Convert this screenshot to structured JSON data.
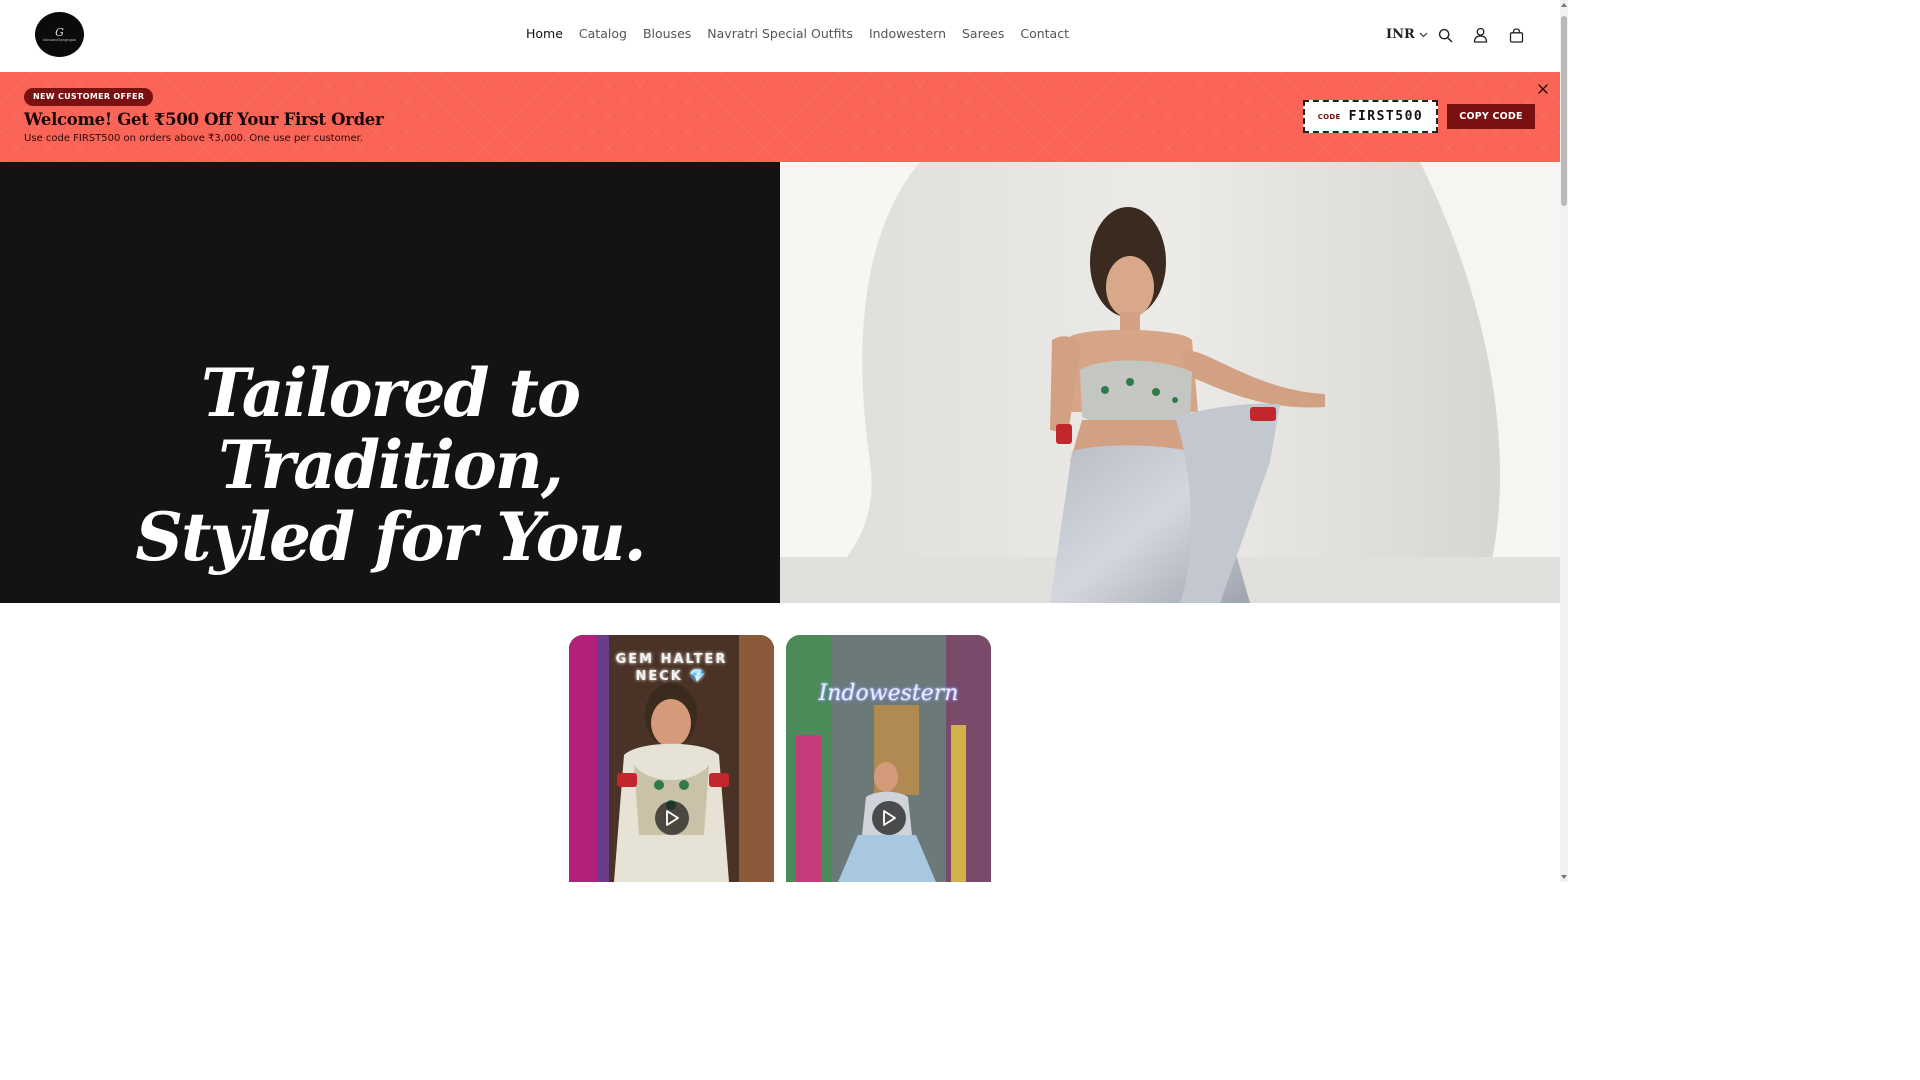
{
  "header": {
    "logo_monogram": "G",
    "logo_text": "shivamsthyagrajan",
    "nav": [
      {
        "label": "Home",
        "active": true
      },
      {
        "label": "Catalog",
        "active": false
      },
      {
        "label": "Blouses",
        "active": false
      },
      {
        "label": "Navratri Special Outfits",
        "active": false
      },
      {
        "label": "Indowestern",
        "active": false
      },
      {
        "label": "Sarees",
        "active": false
      },
      {
        "label": "Contact",
        "active": false
      }
    ],
    "currency": "INR",
    "icons": [
      "search-icon",
      "account-icon",
      "cart-icon"
    ]
  },
  "offer": {
    "badge": "NEW CUSTOMER OFFER",
    "title": "Welcome! Get ₹500 Off Your First Order",
    "subtitle": "Use code FIRST500 on orders above ₹3,000. One use per customer.",
    "code_label": "CODE",
    "code": "FIRST500",
    "copy_label": "COPY CODE",
    "bg_color": "#f96456",
    "accent_color": "#7b1010"
  },
  "hero": {
    "title_lines": [
      "Tailored to",
      "Tradition,",
      "Styled for You."
    ]
  },
  "videos": [
    {
      "caption_lines": [
        "GEM HALTER",
        "NECK 💎"
      ]
    },
    {
      "caption_lines": [
        "Indowestern"
      ]
    }
  ]
}
